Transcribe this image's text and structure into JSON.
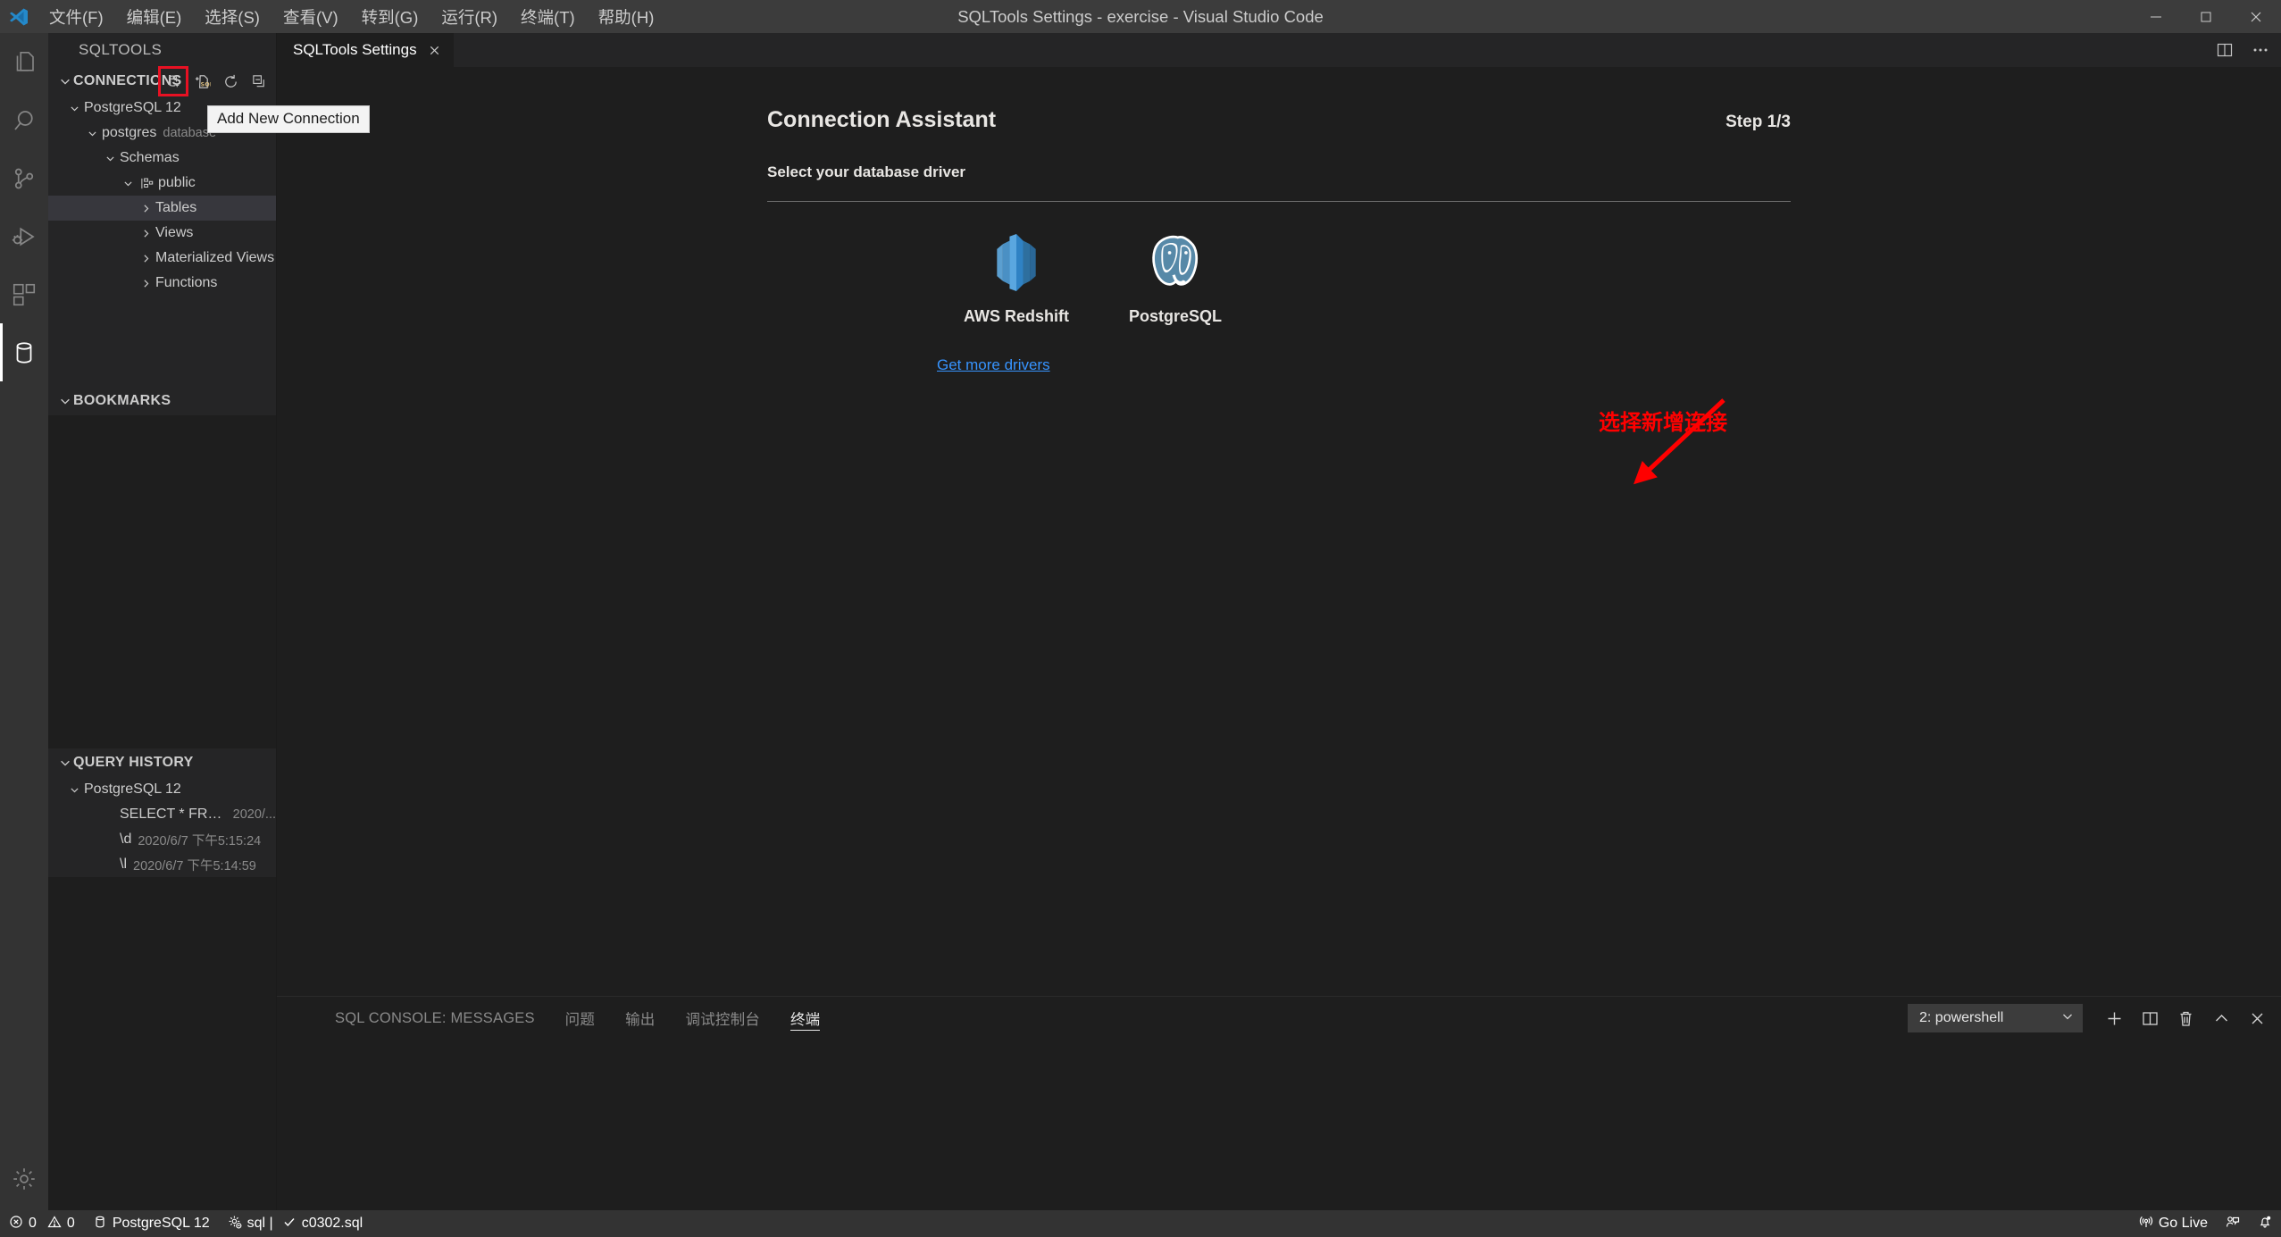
{
  "titlebar": {
    "logo_icon": "vscode-logo",
    "menus": [
      {
        "label": "文件(F)"
      },
      {
        "label": "编辑(E)"
      },
      {
        "label": "选择(S)"
      },
      {
        "label": "查看(V)"
      },
      {
        "label": "转到(G)"
      },
      {
        "label": "运行(R)"
      },
      {
        "label": "终端(T)"
      },
      {
        "label": "帮助(H)"
      }
    ],
    "window_title": "SQLTools Settings - exercise - Visual Studio Code",
    "controls": [
      "minimize",
      "maximize",
      "close"
    ]
  },
  "activitybar": {
    "items": [
      {
        "name": "explorer",
        "icon": "files-icon",
        "active": false
      },
      {
        "name": "search",
        "icon": "search-icon",
        "active": false
      },
      {
        "name": "source-control",
        "icon": "source-control-icon",
        "active": false
      },
      {
        "name": "run-debug",
        "icon": "run-debug-icon",
        "active": false
      },
      {
        "name": "extensions",
        "icon": "extensions-icon",
        "active": false
      },
      {
        "name": "sqltools",
        "icon": "database-icon",
        "active": true
      }
    ],
    "bottom": [
      {
        "name": "manage",
        "icon": "gear-icon"
      }
    ]
  },
  "sidebar": {
    "title": "SQLTOOLS",
    "sections": [
      {
        "name": "connections",
        "label": "CONNECTIONS",
        "expanded": true,
        "actions": [
          {
            "name": "add-new-connection",
            "icon": "add-connection-icon",
            "highlighted": true
          },
          {
            "name": "new-sql-file",
            "icon": "new-sql-file-icon",
            "highlighted": false
          },
          {
            "name": "refresh",
            "icon": "refresh-icon",
            "highlighted": false
          },
          {
            "name": "collapse-all",
            "icon": "collapse-all-icon",
            "highlighted": false
          }
        ],
        "tooltip": "Add New Connection"
      },
      {
        "name": "bookmarks",
        "label": "BOOKMARKS",
        "expanded": true
      },
      {
        "name": "query-history",
        "label": "QUERY HISTORY",
        "expanded": true
      }
    ],
    "connections_tree": [
      {
        "label": "PostgreSQL 12",
        "sub": "",
        "indent": 0,
        "twisty": "down",
        "icon": "",
        "selected": false
      },
      {
        "label": "postgres",
        "sub": "database",
        "indent": 1,
        "twisty": "down",
        "icon": "",
        "selected": false
      },
      {
        "label": "Schemas",
        "sub": "",
        "indent": 2,
        "twisty": "down",
        "icon": "",
        "selected": false
      },
      {
        "label": "public",
        "sub": "",
        "indent": 3,
        "twisty": "down",
        "icon": "schema-icon",
        "selected": false
      },
      {
        "label": "Tables",
        "sub": "",
        "indent": 4,
        "twisty": "right",
        "icon": "",
        "selected": true
      },
      {
        "label": "Views",
        "sub": "",
        "indent": 4,
        "twisty": "right",
        "icon": "",
        "selected": false
      },
      {
        "label": "Materialized Views",
        "sub": "",
        "indent": 4,
        "twisty": "right",
        "icon": "",
        "selected": false
      },
      {
        "label": "Functions",
        "sub": "",
        "indent": 4,
        "twisty": "right",
        "icon": "",
        "selected": false
      }
    ],
    "history_tree": [
      {
        "label": "PostgreSQL 12",
        "sub": "",
        "indent": 0,
        "twisty": "down",
        "selected": false
      },
      {
        "label": "SELECT * FROM room;",
        "sub": "2020/...",
        "indent": 2,
        "twisty": "none",
        "selected": false
      },
      {
        "label": "\\d",
        "sub": "2020/6/7 下午5:15:24",
        "indent": 2,
        "twisty": "none",
        "selected": false
      },
      {
        "label": "\\l",
        "sub": "2020/6/7 下午5:14:59",
        "indent": 2,
        "twisty": "none",
        "selected": false
      }
    ]
  },
  "editor": {
    "tabs": [
      {
        "label": "SQLTools Settings",
        "active": true,
        "close_icon": "close-icon"
      }
    ],
    "actions": [
      {
        "name": "split-editor",
        "icon": "split-editor-icon"
      },
      {
        "name": "more-actions",
        "icon": "ellipsis-icon"
      }
    ]
  },
  "assistant": {
    "title": "Connection Assistant",
    "step": "Step 1/3",
    "subtitle": "Select your database driver",
    "drivers": [
      {
        "name": "AWS Redshift",
        "logo": "redshift-logo"
      },
      {
        "name": "PostgreSQL",
        "logo": "postgresql-logo"
      }
    ],
    "get_more_drivers": "Get more drivers"
  },
  "annotation": {
    "text": "选择新增连接",
    "color": "#ff0000"
  },
  "panel": {
    "tabs": [
      {
        "label": "SQL CONSOLE: MESSAGES",
        "active": false
      },
      {
        "label": "问题",
        "active": false
      },
      {
        "label": "输出",
        "active": false
      },
      {
        "label": "调试控制台",
        "active": false
      },
      {
        "label": "终端",
        "active": true
      }
    ],
    "terminal_select": "2: powershell",
    "actions": [
      {
        "name": "new-terminal",
        "icon": "plus-icon"
      },
      {
        "name": "split-terminal",
        "icon": "split-icon"
      },
      {
        "name": "kill-terminal",
        "icon": "trash-icon"
      },
      {
        "name": "maximize-panel",
        "icon": "chevron-up-icon"
      },
      {
        "name": "close-panel",
        "icon": "close-icon"
      }
    ]
  },
  "statusbar": {
    "left": [
      {
        "name": "problems",
        "icon": "error-icon",
        "label": "0",
        "icon2": "warning-icon",
        "label2": "0"
      },
      {
        "name": "connection",
        "icon": "database-icon",
        "label": "PostgreSQL 12"
      },
      {
        "name": "sql-status",
        "icon": "gear-icon",
        "label": "sql |"
      },
      {
        "name": "current-file",
        "icon": "check-icon",
        "label": "c0302.sql"
      }
    ],
    "right": [
      {
        "name": "go-live",
        "icon": "broadcast-icon",
        "label": "Go Live"
      },
      {
        "name": "feedback",
        "icon": "feedback-icon",
        "label": ""
      },
      {
        "name": "notifications",
        "icon": "bell-dot-icon",
        "label": ""
      }
    ]
  },
  "colors": {
    "accent": "#0e639c",
    "link": "#3794ff",
    "annotation": "#ff0000",
    "titlebar_bg": "#3c3c3c",
    "sidebar_bg": "#252526",
    "editor_bg": "#1e1e1e",
    "statusbar_bg": "#333333"
  }
}
